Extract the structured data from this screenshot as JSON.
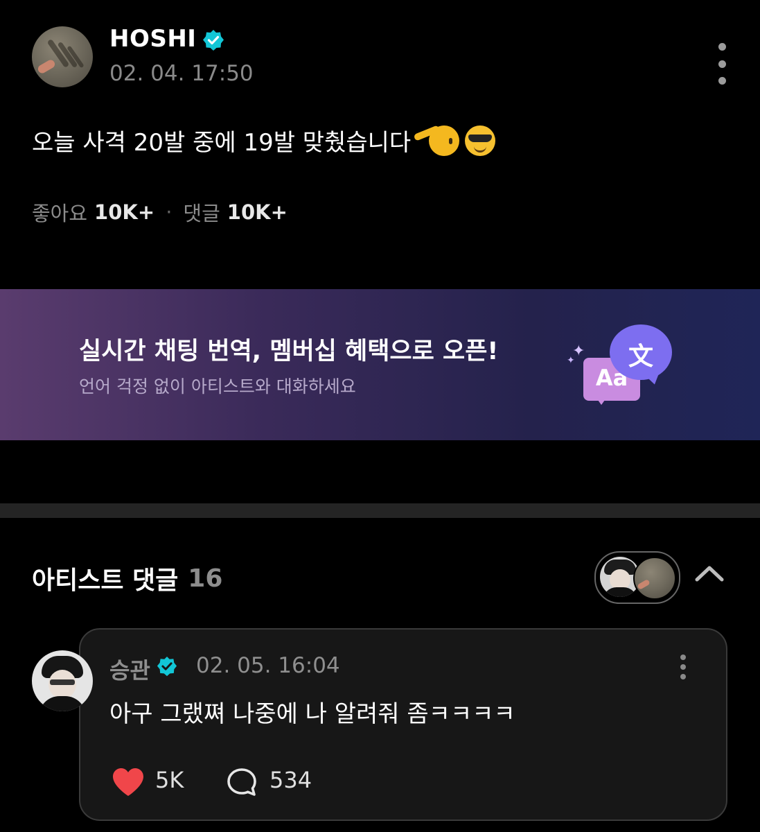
{
  "post": {
    "username": "HOSHI",
    "timestamp": "02. 04. 17:50",
    "text": "오늘 사격 20발 중에 19발 맞췄습니다",
    "emojis": [
      "saluting-face",
      "smiling-face-with-sunglasses"
    ],
    "stats": {
      "likes_label": "좋아요",
      "likes_value": "10K+",
      "separator": "·",
      "comments_label": "댓글",
      "comments_value": "10K+"
    }
  },
  "banner": {
    "title": "실시간 채팅 번역, 멤버십 혜택으로 오픈!",
    "subtitle": "언어 걱정 없이 아티스트와 대화하세요",
    "icon_aa": "Aa",
    "icon_zh": "文"
  },
  "artist_comments": {
    "title": "아티스트 댓글",
    "count": "16"
  },
  "comment": {
    "author": "승관",
    "timestamp": "02. 05. 16:04",
    "text": "아구 그랬쪄 나중에 나 알려줘 좀ㅋㅋㅋㅋ",
    "likes": "5K",
    "replies": "534"
  },
  "colors": {
    "background": "#000000",
    "verified": "#12c6d6",
    "heart": "#f0464a",
    "muted_text": "#8a8a8a"
  }
}
